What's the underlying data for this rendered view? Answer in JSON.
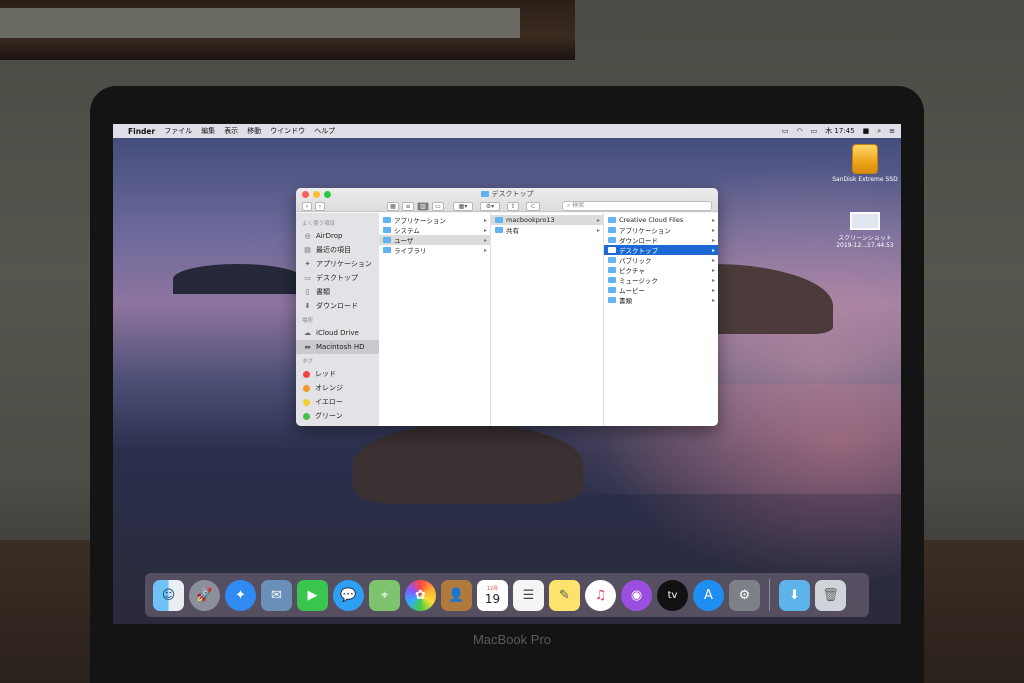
{
  "menubar": {
    "app": "Finder",
    "items": [
      "ファイル",
      "編集",
      "表示",
      "移動",
      "ウインドウ",
      "ヘルプ"
    ],
    "clock": "木 17:45"
  },
  "desktop_icons": [
    {
      "label": "SanDisk Extreme SSD"
    },
    {
      "label": "スクリーンショット 2019-12...17.44.53"
    }
  ],
  "finder": {
    "title": "デスクトップ",
    "search_placeholder": "検索",
    "sidebar": {
      "favorites_header": "よく使う項目",
      "favorites": [
        "AirDrop",
        "最近の項目",
        "アプリケーション",
        "デスクトップ",
        "書類",
        "ダウンロード"
      ],
      "locations_header": "場所",
      "locations": [
        "iCloud Drive",
        "Macintosh HD"
      ],
      "tags_header": "タグ",
      "tags": [
        {
          "label": "レッド",
          "color": "#f0463c"
        },
        {
          "label": "オレンジ",
          "color": "#f39a2b"
        },
        {
          "label": "イエロー",
          "color": "#f4cf2f"
        },
        {
          "label": "グリーン",
          "color": "#44c149"
        }
      ]
    },
    "columns": [
      [
        "アプリケーション",
        "システム",
        "ユーザ",
        "ライブラリ"
      ],
      [
        "macbookpro13",
        "共有"
      ],
      [
        "Creative Cloud Files",
        "アプリケーション",
        "ダウンロード",
        "デスクトップ",
        "パブリック",
        "ピクチャ",
        "ミュージック",
        "ムービー",
        "書類"
      ]
    ]
  },
  "dock": {
    "calendar_month": "12月",
    "calendar_day": "19",
    "tv_label": "tv"
  },
  "brand": "MacBook Pro",
  "colors": {
    "selection": "#1d69d4",
    "folder": "#62b4f0"
  }
}
